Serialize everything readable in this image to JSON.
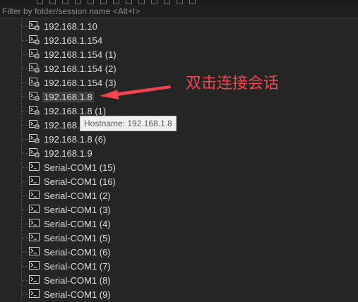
{
  "filter": {
    "placeholder": "Filter by folder/session name <Alt+I>",
    "value": ""
  },
  "sessions": [
    {
      "label": "192.168.1.10",
      "icon": "ssh-session-icon"
    },
    {
      "label": "192.168.1.154",
      "icon": "ssh-session-icon"
    },
    {
      "label": "192.168.1.154 (1)",
      "icon": "ssh-session-icon"
    },
    {
      "label": "192.168.1.154 (2)",
      "icon": "ssh-session-icon"
    },
    {
      "label": "192.168.1.154 (3)",
      "icon": "ssh-session-icon"
    },
    {
      "label": "192.168.1.8",
      "icon": "ssh-session-icon",
      "selected": true
    },
    {
      "label": "192.168.1.8 (1)",
      "icon": "ssh-session-icon"
    },
    {
      "label": "192.168.1.8",
      "icon": "ssh-session-icon"
    },
    {
      "label": "192.168.1.8 (6)",
      "icon": "ssh-session-icon"
    },
    {
      "label": "192.168.1.9",
      "icon": "ssh-session-icon"
    },
    {
      "label": "Serial-COM1 (15)",
      "icon": "serial-session-icon"
    },
    {
      "label": "Serial-COM1 (16)",
      "icon": "serial-session-icon"
    },
    {
      "label": "Serial-COM1 (2)",
      "icon": "serial-session-icon"
    },
    {
      "label": "Serial-COM1 (3)",
      "icon": "serial-session-icon"
    },
    {
      "label": "Serial-COM1 (4)",
      "icon": "serial-session-icon"
    },
    {
      "label": "Serial-COM1 (5)",
      "icon": "serial-session-icon"
    },
    {
      "label": "Serial-COM1 (6)",
      "icon": "serial-session-icon"
    },
    {
      "label": "Serial-COM1 (7)",
      "icon": "serial-session-icon"
    },
    {
      "label": "Serial-COM1 (8)",
      "icon": "serial-session-icon"
    },
    {
      "label": "Serial-COM1 (9)",
      "icon": "serial-session-icon"
    }
  ],
  "tooltip": {
    "text": "Hostname: 192.168.1.8"
  },
  "annotation": {
    "text": "双击连接会话",
    "color": "#f2444e"
  },
  "colors": {
    "background": "#252526",
    "text": "#dcdcdc",
    "selection": "#3d3d40"
  }
}
